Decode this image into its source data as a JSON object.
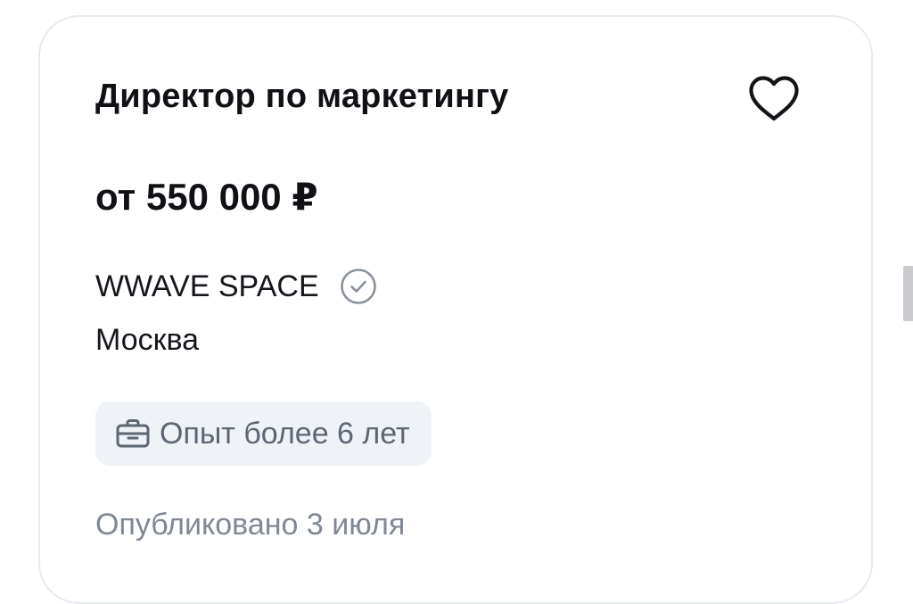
{
  "vacancy": {
    "title": "Директор по маркетингу",
    "salary": "от 550 000 ₽",
    "company": "WWAVE SPACE",
    "city": "Москва",
    "experience": "Опыт более 6 лет",
    "published": "Опубликовано 3 июля"
  },
  "icons": {
    "favorite": "heart-outline-icon",
    "verified": "check-circle-icon",
    "experience": "briefcase-icon"
  },
  "colors": {
    "card_border": "#e6e9ee",
    "chip_bg": "#eff2f6",
    "muted_text": "#7f8894",
    "primary_text": "#0f1115"
  }
}
